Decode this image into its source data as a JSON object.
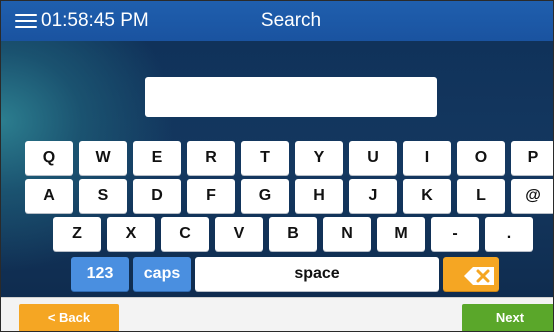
{
  "header": {
    "time": "01:58:45 PM",
    "title": "Search"
  },
  "search": {
    "value": "",
    "placeholder": ""
  },
  "keyboard": {
    "row1": [
      "Q",
      "W",
      "E",
      "R",
      "T",
      "Y",
      "U",
      "I",
      "O",
      "P"
    ],
    "row2": [
      "A",
      "S",
      "D",
      "F",
      "G",
      "H",
      "J",
      "K",
      "L",
      "@"
    ],
    "row3": [
      "Z",
      "X",
      "C",
      "V",
      "B",
      "N",
      "M",
      "-",
      "."
    ],
    "numbers_label": "123",
    "caps_label": "caps",
    "space_label": "space",
    "backspace_icon": "backspace-icon"
  },
  "footer": {
    "back_label": "< Back",
    "next_label": "Next"
  },
  "colors": {
    "header": "#1f5fae",
    "key_blue": "#4a8fe0",
    "key_orange": "#f5a623",
    "back_button": "#f5a623",
    "next_button": "#5aa72a"
  }
}
